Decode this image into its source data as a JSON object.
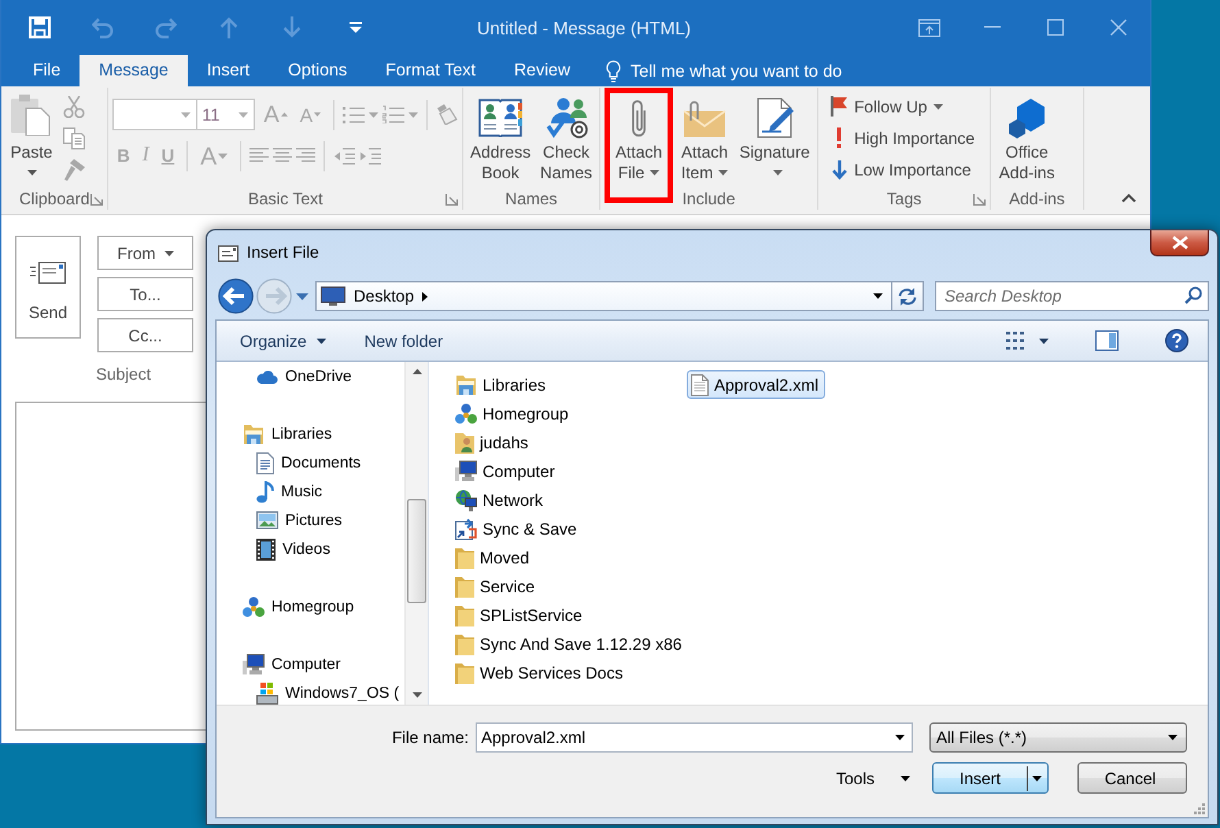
{
  "outlook_window": {
    "title": "Untitled - Message (HTML)",
    "quick_access": [
      {
        "kind": "save",
        "disabled": false
      },
      {
        "kind": "undo",
        "disabled": true
      },
      {
        "kind": "redo",
        "disabled": true
      },
      {
        "kind": "up",
        "disabled": true
      },
      {
        "kind": "down",
        "disabled": true
      },
      {
        "kind": "customize",
        "disabled": false
      }
    ]
  },
  "ribbon": {
    "tabs": [
      {
        "label": "File",
        "selected": false
      },
      {
        "label": "Message",
        "selected": true
      },
      {
        "label": "Insert",
        "selected": false
      },
      {
        "label": "Options",
        "selected": false
      },
      {
        "label": "Format Text",
        "selected": false
      },
      {
        "label": "Review",
        "selected": false
      }
    ],
    "tell_me": "Tell me what you want to do",
    "groups": [
      {
        "kind": "clipboard",
        "label": "Clipboard",
        "launcher": true,
        "disabled": true,
        "paste": "Paste"
      },
      {
        "kind": "basic_text",
        "label": "Basic Text",
        "launcher": true,
        "disabled": true,
        "font_size": "11",
        "grow_font": "A",
        "shrink_font": "A",
        "bold": "B",
        "italic": "I",
        "underline": "U",
        "font_color": "A"
      },
      {
        "kind": "large_buttons",
        "label": "Names",
        "launcher": false,
        "buttons": [
          {
            "kind": "address_book",
            "label": "Address Book",
            "menu": false,
            "highlighted": false
          },
          {
            "kind": "check_names",
            "label": "Check Names",
            "menu": false,
            "highlighted": false
          }
        ]
      },
      {
        "kind": "large_buttons",
        "label": "Include",
        "launcher": false,
        "buttons": [
          {
            "kind": "attach_file",
            "label": "Attach File",
            "menu": true,
            "highlighted": true
          },
          {
            "kind": "attach_item",
            "label": "Attach Item",
            "menu": true,
            "highlighted": false
          },
          {
            "kind": "signature",
            "label": "Signature",
            "menu": true,
            "highlighted": false
          }
        ]
      },
      {
        "kind": "tags",
        "label": "Tags",
        "launcher": true,
        "items": [
          {
            "kind": "follow_up",
            "label": "Follow Up",
            "menu": true
          },
          {
            "kind": "high_importance",
            "label": "High Importance",
            "menu": false
          },
          {
            "kind": "low_importance",
            "label": "Low Importance",
            "menu": false
          }
        ]
      },
      {
        "kind": "large_buttons",
        "label": "Add-ins",
        "launcher": false,
        "buttons": [
          {
            "kind": "office_addins",
            "label": "Office Add-ins",
            "menu": false,
            "highlighted": false
          }
        ]
      }
    ]
  },
  "compose": {
    "send": "Send",
    "from": "From",
    "to": "To...",
    "cc": "Cc...",
    "subject_label": "Subject"
  },
  "dialog": {
    "title": "Insert File",
    "address": "Desktop",
    "search": {
      "placeholder": "Search Desktop"
    },
    "toolbar": {
      "organize": "Organize",
      "new_folder": "New folder"
    },
    "nav_tree": [
      {
        "children": [
          {
            "kind": "onedrive",
            "label": "OneDrive",
            "selected": false
          }
        ]
      },
      {
        "kind": "libraries",
        "label": "Libraries",
        "selected": false,
        "children": [
          {
            "kind": "documents",
            "label": "Documents",
            "selected": false
          },
          {
            "kind": "music",
            "label": "Music",
            "selected": false
          },
          {
            "kind": "pictures",
            "label": "Pictures",
            "selected": false
          },
          {
            "kind": "videos",
            "label": "Videos",
            "selected": false
          }
        ]
      },
      {
        "kind": "homegroup",
        "label": "Homegroup",
        "selected": false
      },
      {
        "kind": "computer",
        "label": "Computer",
        "selected": false,
        "children": [
          {
            "kind": "drive",
            "label": "Windows7_OS (",
            "selected": false
          }
        ]
      }
    ],
    "files": [
      {
        "kind": "libraries",
        "name": "Libraries",
        "selected": false
      },
      {
        "kind": "homegroup",
        "name": "Homegroup",
        "selected": false
      },
      {
        "kind": "user_folder",
        "name": "judahs",
        "selected": false
      },
      {
        "kind": "computer",
        "name": "Computer",
        "selected": false
      },
      {
        "kind": "network",
        "name": "Network",
        "selected": false
      },
      {
        "kind": "shortcut",
        "name": "Sync & Save",
        "selected": false
      },
      {
        "kind": "folder",
        "name": "Moved",
        "selected": false
      },
      {
        "kind": "folder",
        "name": "Service",
        "selected": false
      },
      {
        "kind": "folder",
        "name": "SPListService",
        "selected": false
      },
      {
        "kind": "folder",
        "name": "Sync And Save 1.12.29 x86",
        "selected": false
      },
      {
        "kind": "folder",
        "name": "Web Services Docs",
        "selected": false
      },
      {
        "kind": "file",
        "name": "Approval2.xml",
        "selected": true
      }
    ],
    "file_name_label": "File name:",
    "file_name": "Approval2.xml",
    "file_type": "All Files (*.*)",
    "tools": "Tools",
    "buttons": [
      {
        "kind": "split",
        "label": "Insert",
        "default": true
      },
      {
        "kind": "plain",
        "label": "Cancel",
        "default": false
      }
    ]
  }
}
